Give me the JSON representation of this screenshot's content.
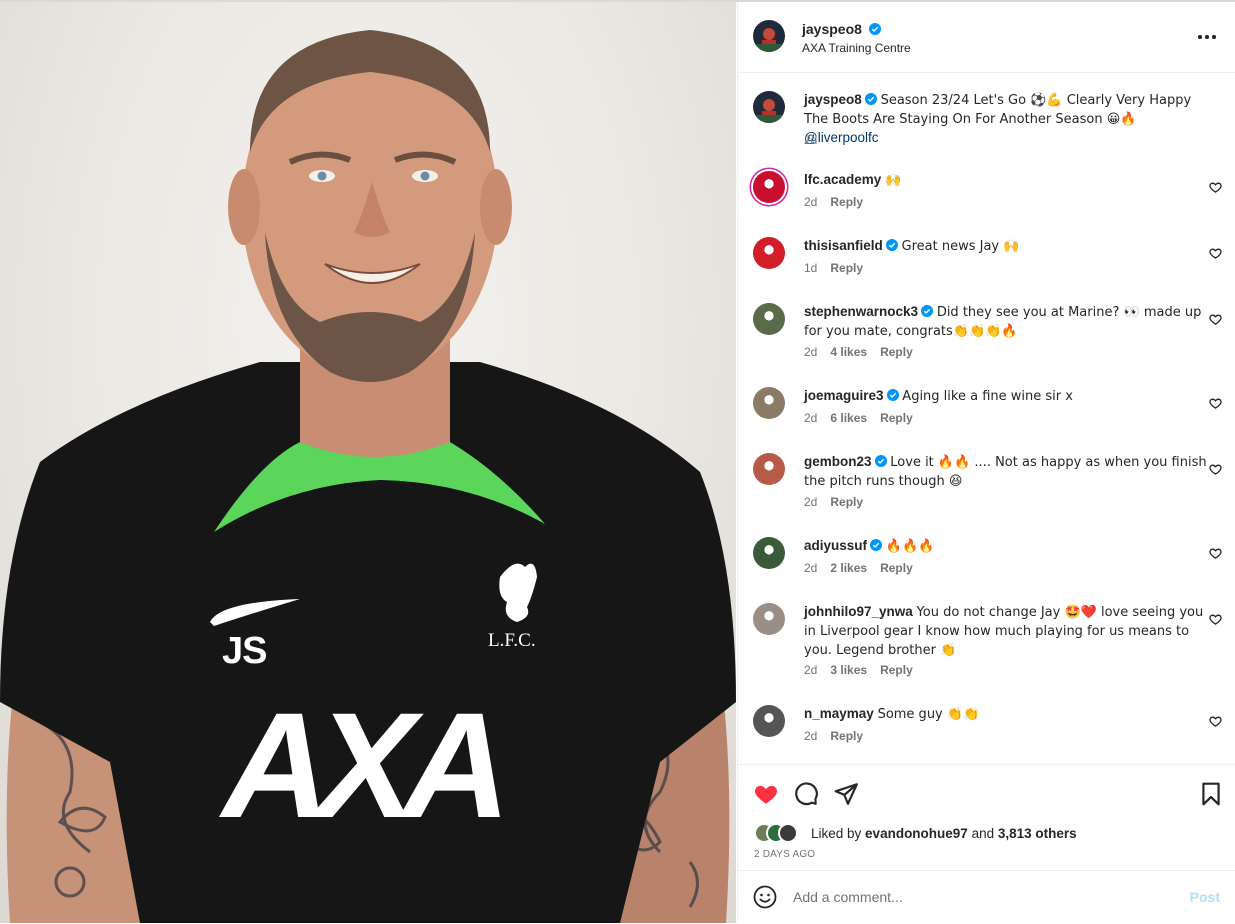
{
  "post": {
    "username": "jayspeo8",
    "location": "AXA Training Centre",
    "caption": {
      "username": "jayspeo8",
      "text": "Season 23/24 Let's Go ⚽💪 Clearly Very Happy The Boots Are Staying On For Another Season 😀🔥 ",
      "mention": "@liverpoolfc",
      "time": "2d"
    },
    "shirt_initials": "JS",
    "shirt_sponsor": "AXA",
    "shirt_crest": "L.F.C."
  },
  "comments": [
    {
      "username": "lfc.academy",
      "verified": false,
      "text": "🙌",
      "time": "2d",
      "likes": "",
      "reply": "Reply",
      "color": "#c8102e"
    },
    {
      "username": "thisisanfield",
      "verified": true,
      "text": "Great news Jay 🙌",
      "time": "1d",
      "likes": "",
      "reply": "Reply",
      "color": "#d21d2a"
    },
    {
      "username": "stephenwarnock3",
      "verified": true,
      "text": "Did they see you at Marine? 👀 made up for you mate, congrats👏👏👏🔥",
      "time": "2d",
      "likes": "4 likes",
      "reply": "Reply",
      "color": "#5a6b4a"
    },
    {
      "username": "joemaguire3",
      "verified": true,
      "text": "Aging like a fine wine sir x",
      "time": "2d",
      "likes": "6 likes",
      "reply": "Reply",
      "color": "#8a7a66"
    },
    {
      "username": "gembon23",
      "verified": true,
      "text": "Love it 🔥🔥 .... Not as happy as when you finish the pitch runs though 😆",
      "time": "2d",
      "likes": "",
      "reply": "Reply",
      "color": "#b85a4a"
    },
    {
      "username": "adiyussuf",
      "verified": true,
      "text": "🔥🔥🔥",
      "time": "2d",
      "likes": "2 likes",
      "reply": "Reply",
      "color": "#3a5a3a"
    },
    {
      "username": "johnhilo97_ynwa",
      "verified": false,
      "text": "You do not change Jay 🤩❤️ love seeing you in Liverpool gear I know how much playing for us means to you. Legend brother 👏",
      "time": "2d",
      "likes": "3 likes",
      "reply": "Reply",
      "color": "#9a8f86"
    },
    {
      "username": "n_maymay",
      "verified": false,
      "text": "Some guy 👏👏",
      "time": "2d",
      "likes": "",
      "reply": "Reply",
      "color": "#555555"
    }
  ],
  "footer": {
    "liked_by_prefix": "Liked by ",
    "liked_by_user": "evandonohue97",
    "liked_by_and": " and ",
    "liked_by_others": "3,813 others",
    "time_ago": "2 DAYS AGO",
    "comment_placeholder": "Add a comment...",
    "post_label": "Post"
  },
  "colors": {
    "like_red": "#ff3040",
    "verified_blue": "#0095f6",
    "post_disabled": "#b2dffc",
    "shirt_black": "#161616",
    "collar_green": "#5bd65b"
  },
  "icons": [
    "more-icon",
    "verified-icon",
    "heart-icon",
    "comment-icon",
    "share-icon",
    "bookmark-icon",
    "emoji-icon"
  ]
}
